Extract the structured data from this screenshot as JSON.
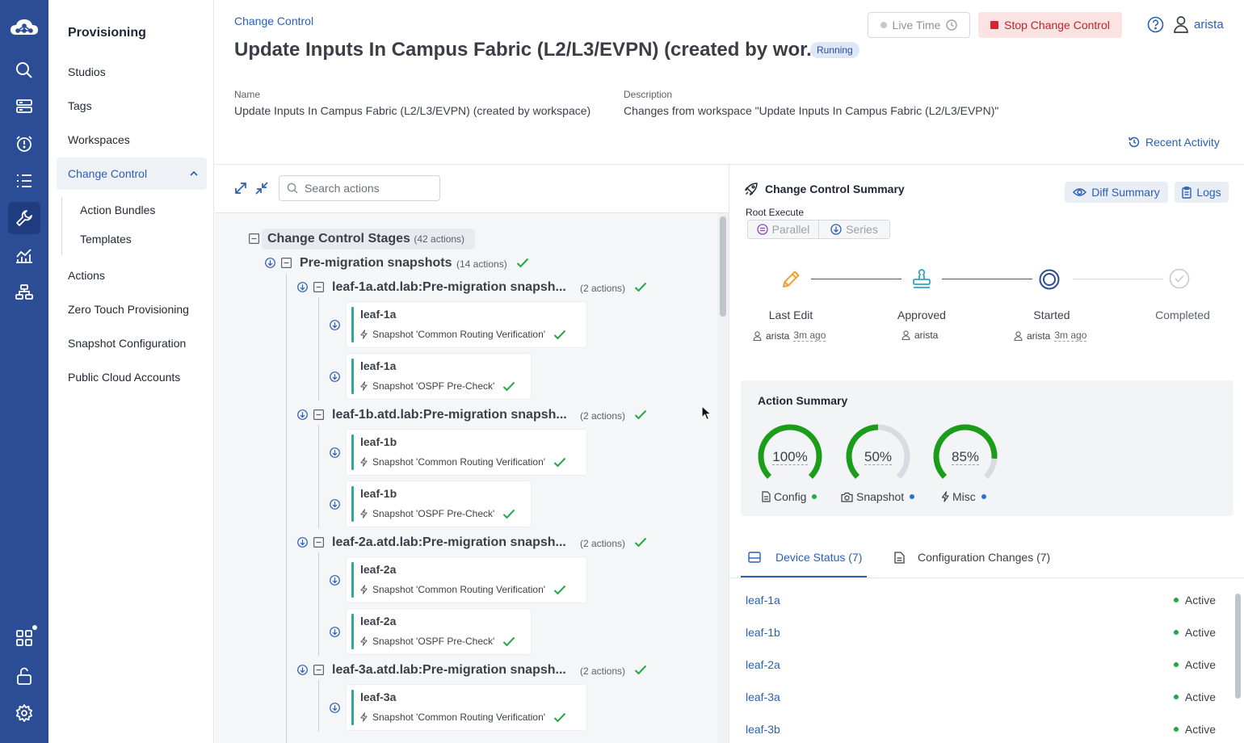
{
  "nav": {
    "title": "Provisioning",
    "items": [
      {
        "label": "Studios"
      },
      {
        "label": "Tags"
      },
      {
        "label": "Workspaces"
      }
    ],
    "active": {
      "label": "Change Control"
    },
    "sub_items": [
      {
        "label": "Action Bundles"
      },
      {
        "label": "Templates"
      }
    ],
    "items_after": [
      {
        "label": "Actions"
      },
      {
        "label": "Zero Touch Provisioning"
      },
      {
        "label": "Snapshot Configuration"
      },
      {
        "label": "Public Cloud Accounts"
      }
    ]
  },
  "header": {
    "breadcrumb": "Change Control",
    "title": "Update Inputs In Campus Fabric (L2/L3/EVPN) (created by wor...",
    "status_badge": "Running",
    "live_time_label": "Live Time",
    "stop_label": "Stop Change Control",
    "user": "arista",
    "name_label": "Name",
    "name_value": "Update Inputs In Campus Fabric (L2/L3/EVPN) (created by workspace)",
    "description_label": "Description",
    "description_value": "Changes from workspace \"Update Inputs In Campus Fabric (L2/L3/EVPN)\"",
    "recent_activity": "Recent Activity"
  },
  "tree": {
    "search_placeholder": "Search actions",
    "root_label": "Change Control Stages",
    "root_count": "(42 actions)",
    "stage_label": "Pre-migration snapshots",
    "stage_count": "(14 actions)",
    "groups": [
      {
        "label": "leaf-1a.atd.lab:Pre-migration snapsh...",
        "count": "(2 actions)",
        "actions": [
          {
            "device": "leaf-1a",
            "action": "Snapshot 'Common Routing Verification'"
          },
          {
            "device": "leaf-1a",
            "action": "Snapshot 'OSPF Pre-Check'"
          }
        ]
      },
      {
        "label": "leaf-1b.atd.lab:Pre-migration snapsh...",
        "count": "(2 actions)",
        "actions": [
          {
            "device": "leaf-1b",
            "action": "Snapshot 'Common Routing Verification'"
          },
          {
            "device": "leaf-1b",
            "action": "Snapshot 'OSPF Pre-Check'"
          }
        ]
      },
      {
        "label": "leaf-2a.atd.lab:Pre-migration snapsh...",
        "count": "(2 actions)",
        "actions": [
          {
            "device": "leaf-2a",
            "action": "Snapshot 'Common Routing Verification'"
          },
          {
            "device": "leaf-2a",
            "action": "Snapshot 'OSPF Pre-Check'"
          }
        ]
      },
      {
        "label": "leaf-3a.atd.lab:Pre-migration snapsh...",
        "count": "(2 actions)",
        "actions": [
          {
            "device": "leaf-3a",
            "action": "Snapshot 'Common Routing Verification'"
          }
        ]
      }
    ]
  },
  "summary": {
    "title": "Change Control Summary",
    "diff_summary": "Diff Summary",
    "logs": "Logs",
    "root_execute": "Root Execute",
    "parallel": "Parallel",
    "series": "Series",
    "steps": [
      {
        "label": "Last Edit",
        "user": "arista",
        "ago": "3m ago"
      },
      {
        "label": "Approved",
        "user": "arista",
        "ago": ""
      },
      {
        "label": "Started",
        "user": "arista",
        "ago": "3m ago"
      },
      {
        "label": "Completed",
        "user": "",
        "ago": ""
      }
    ],
    "action_summary_title": "Action Summary",
    "gauges": [
      {
        "value": 100,
        "display": "100%",
        "label": "Config",
        "dot_color": "#22a846",
        "icon": "document-icon"
      },
      {
        "value": 50,
        "display": "50%",
        "label": "Snapshot",
        "dot_color": "#2b6fd6",
        "icon": "camera-icon"
      },
      {
        "value": 85,
        "display": "85%",
        "label": "Misc",
        "dot_color": "#2b6fd6",
        "icon": "lightning-icon"
      }
    ],
    "tabs": [
      {
        "label": "Device Status (7)",
        "active": true
      },
      {
        "label": "Configuration Changes (7)",
        "active": false
      }
    ],
    "devices": [
      {
        "name": "leaf-1a",
        "status": "Active"
      },
      {
        "name": "leaf-1b",
        "status": "Active"
      },
      {
        "name": "leaf-2a",
        "status": "Active"
      },
      {
        "name": "leaf-3a",
        "status": "Active"
      },
      {
        "name": "leaf-3b",
        "status": "Active"
      }
    ]
  },
  "colors": {
    "rail": "#2a4d96",
    "accent": "#2b5fb3",
    "success": "#22a846",
    "gauge_green": "#1a9e1a",
    "stop_bg": "#fbe3e3",
    "stop_text": "#c8202c",
    "teal": "#2fa7a0"
  }
}
